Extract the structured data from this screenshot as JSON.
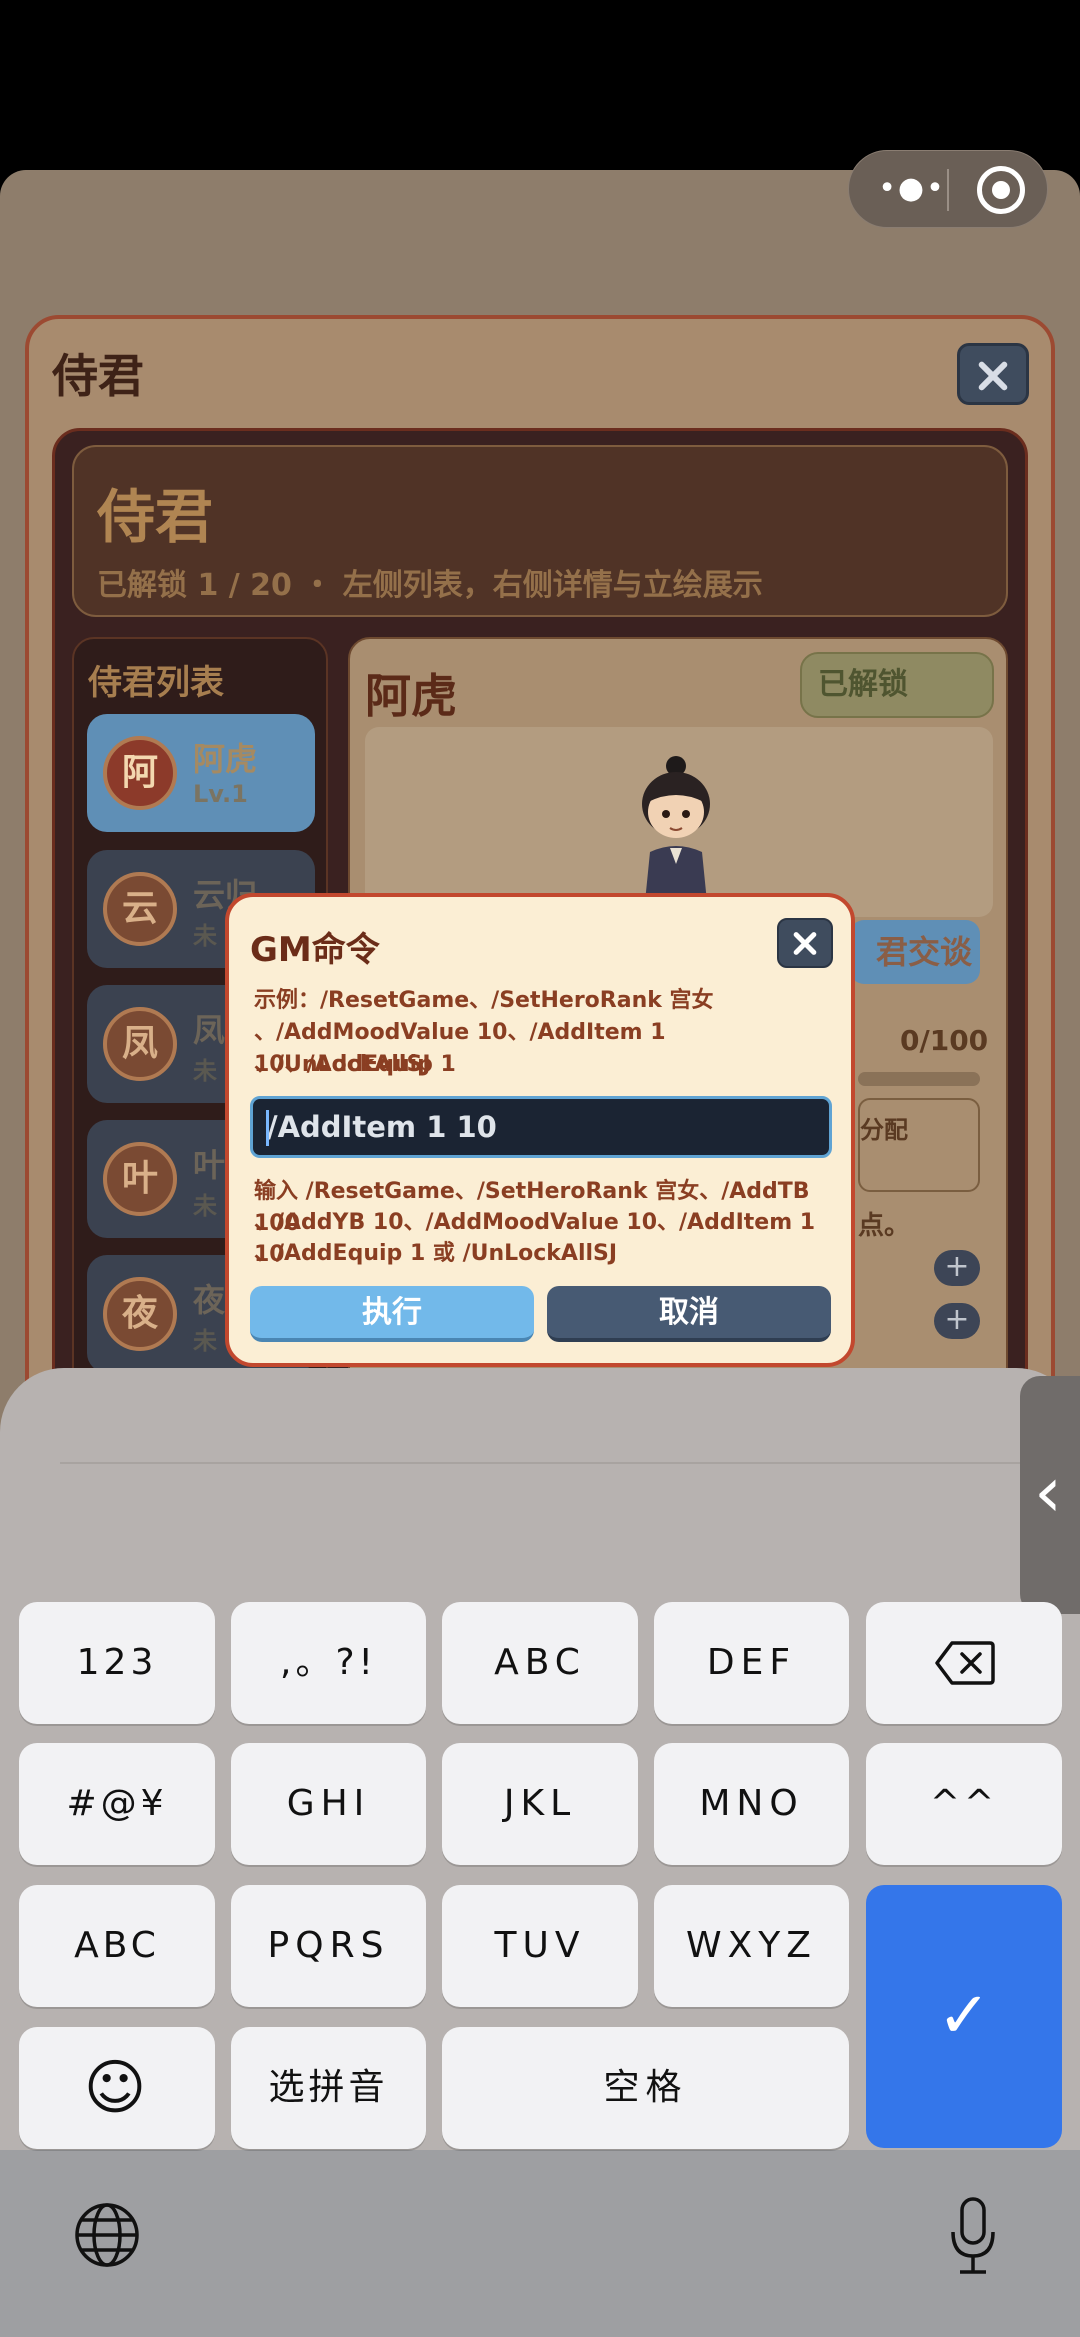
{
  "screen": {
    "panel_title": "侍君",
    "header_title": "侍君",
    "header_sub": "已解锁 1 / 20 ・ 左侧列表，右侧详情与立绘展示",
    "list_title": "侍君列表",
    "list_items": [
      {
        "avatar": "阿",
        "name": "阿虎",
        "level": "Lv.1"
      },
      {
        "avatar": "云",
        "name": "云归",
        "level": "未"
      },
      {
        "avatar": "凤",
        "name": "凤",
        "level": "未"
      },
      {
        "avatar": "叶",
        "name": "叶",
        "level": "未"
      },
      {
        "avatar": "夜",
        "name": "夜",
        "level": "未"
      }
    ],
    "detail_name": "阿虎",
    "unlock_badge": "已解锁",
    "talk_label": "君交谈",
    "mood_value": "0/100",
    "allot_label": "分配",
    "point_suffix": "点。"
  },
  "gm_modal": {
    "title": "GM命令",
    "example_lines": [
      "示例：/ResetGame、/SetHeroRank 宫女",
      "、/AddMoodValue 10、/AddItem 1 10、/AddEquip 1",
      "、/UnLockAllSJ"
    ],
    "input_value": "/AddItem 1 10",
    "help_lines": [
      "输入 /ResetGame、/SetHeroRank 宫女、/AddTB 100",
      "、/AddYB 10、/AddMoodValue 10、/AddItem 1 10",
      "、/AddEquip 1 或 /UnLockAllSJ"
    ],
    "execute_label": "执行",
    "cancel_label": "取消"
  },
  "capsule": {
    "more_icon": "more-dots-icon",
    "close_icon": "target-circle-icon"
  },
  "keyboard": {
    "row1": [
      "123",
      ",。?!",
      "ABC",
      "DEF"
    ],
    "row2": [
      "#@¥",
      "GHI",
      "JKL",
      "MNO",
      "^^"
    ],
    "row3": [
      "ABC",
      "PQRS",
      "TUV",
      "WXYZ"
    ],
    "row4": [
      "选拼音",
      "空格"
    ],
    "confirm_glyph": "✓",
    "emoji_glyph": "☺",
    "side_tab_glyph": "‹",
    "accent": "#3476ea"
  }
}
